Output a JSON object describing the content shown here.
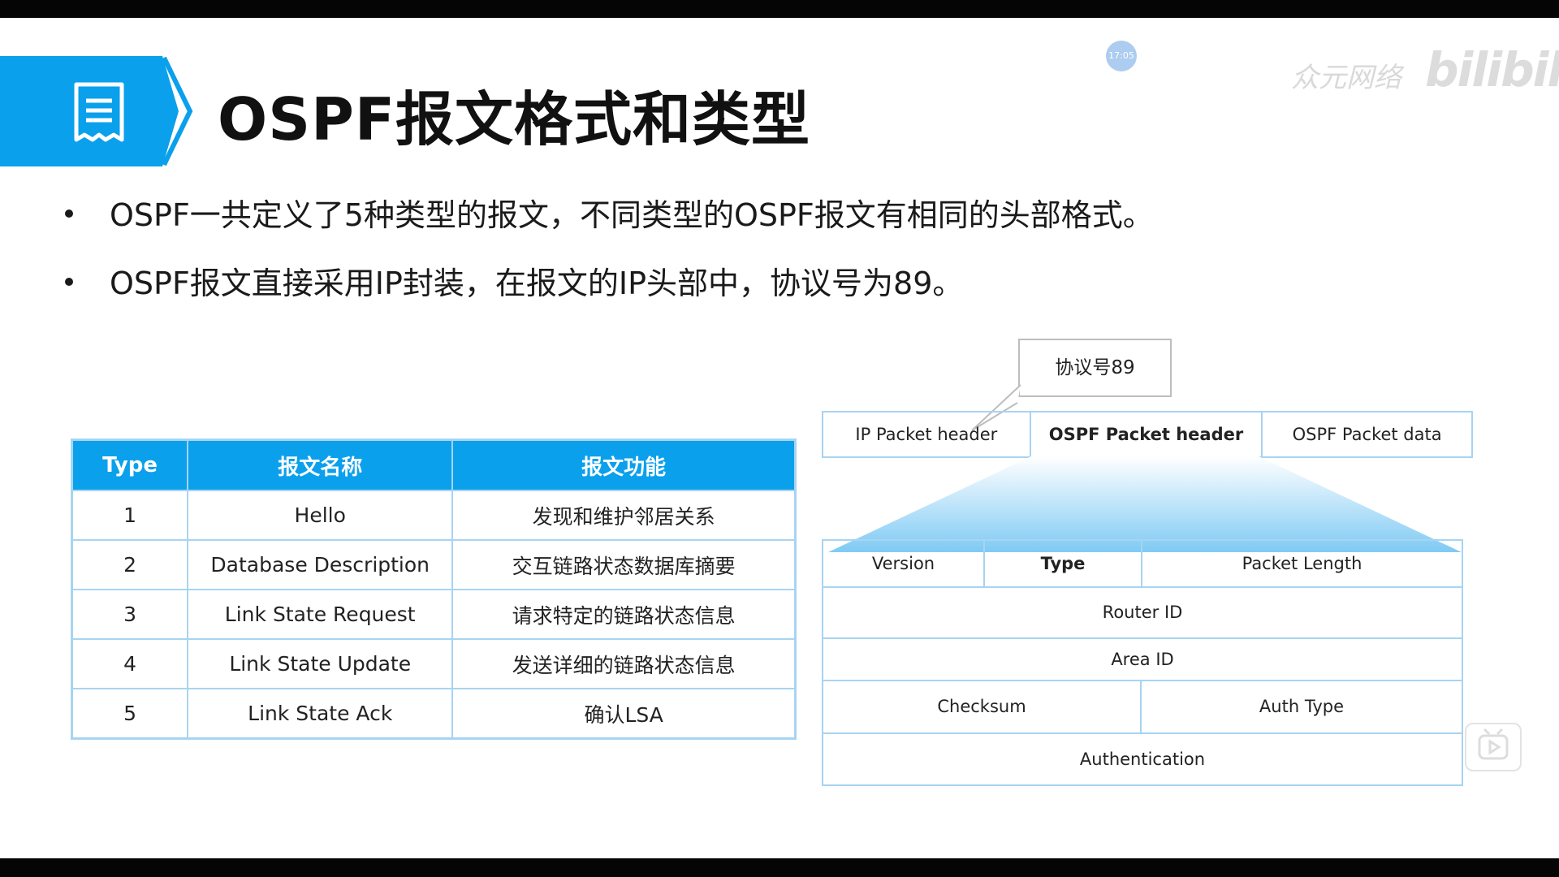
{
  "slide": {
    "title": "OSPF报文格式和类型",
    "bullets": [
      "OSPF一共定义了5种类型的报文，不同类型的OSPF报文有相同的头部格式。",
      "OSPF报文直接采用IP封装，在报文的IP头部中，协议号为89。"
    ]
  },
  "watermark": {
    "time": "17:05",
    "author": "众元网络",
    "brand": "bilibili"
  },
  "type_table": {
    "headers": [
      "Type",
      "报文名称",
      "报文功能"
    ],
    "rows": [
      [
        "1",
        "Hello",
        "发现和维护邻居关系"
      ],
      [
        "2",
        "Database Description",
        "交互链路状态数据库摘要"
      ],
      [
        "3",
        "Link State Request",
        "请求特定的链路状态信息"
      ],
      [
        "4",
        "Link State Update",
        "发送详细的链路状态信息"
      ],
      [
        "5",
        "Link State Ack",
        "确认LSA"
      ]
    ]
  },
  "diagram": {
    "callout": "协议号89",
    "packet": [
      "IP Packet header",
      "OSPF Packet header",
      "OSPF Packet data"
    ],
    "header_fields": {
      "version": "Version",
      "type": "Type",
      "packet_length": "Packet Length",
      "router_id": "Router ID",
      "area_id": "Area ID",
      "checksum": "Checksum",
      "auth_type": "Auth Type",
      "authentication": "Authentication"
    }
  },
  "colors": {
    "accent": "#0aa0ec",
    "table_border": "#a7d4f2"
  }
}
